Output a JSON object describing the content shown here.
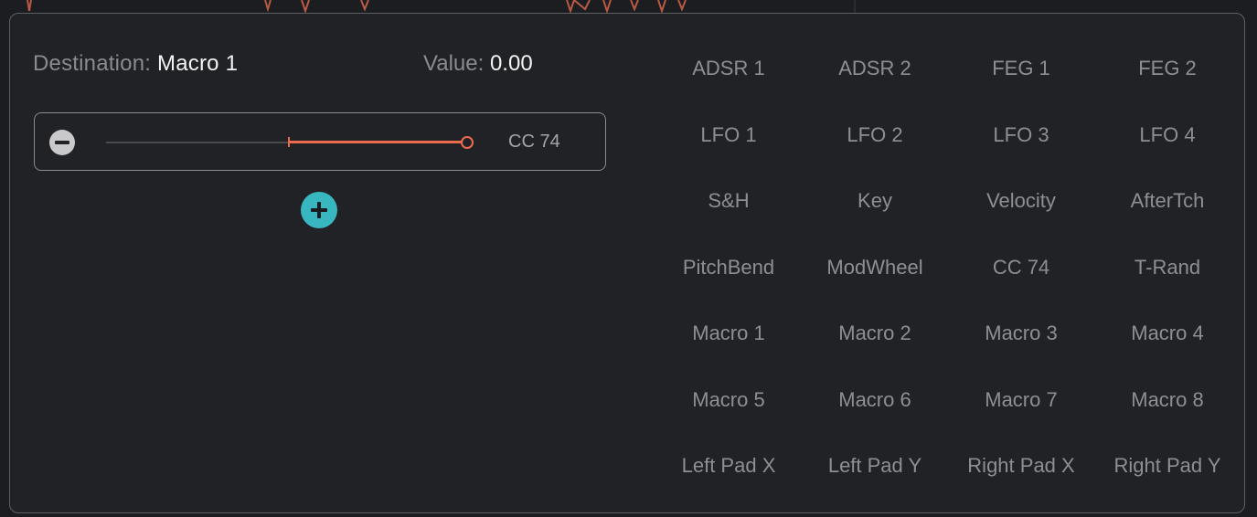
{
  "header": {
    "destination_label": "Destination:",
    "destination_value": "Macro 1",
    "value_label": "Value:",
    "value_value": "0.00"
  },
  "modulation": {
    "source_label": "CC 74",
    "amount_fraction_start": 0.5,
    "amount_fraction_end": 1.0
  },
  "sources": [
    "ADSR 1",
    "ADSR 2",
    "FEG 1",
    "FEG 2",
    "LFO 1",
    "LFO 2",
    "LFO 3",
    "LFO 4",
    "S&H",
    "Key",
    "Velocity",
    "AfterTch",
    "PitchBend",
    "ModWheel",
    "CC 74",
    "T-Rand",
    "Macro 1",
    "Macro 2",
    "Macro 3",
    "Macro 4",
    "Macro 5",
    "Macro 6",
    "Macro 7",
    "Macro 8",
    "Left Pad X",
    "Left Pad Y",
    "Right Pad X",
    "Right Pad Y"
  ],
  "colors": {
    "accent": "#ec6a4f",
    "add_button": "#39b7c0",
    "panel_bg": "#212226"
  },
  "icons": {
    "remove": "minus-circle-icon",
    "add": "plus-circle-icon"
  }
}
